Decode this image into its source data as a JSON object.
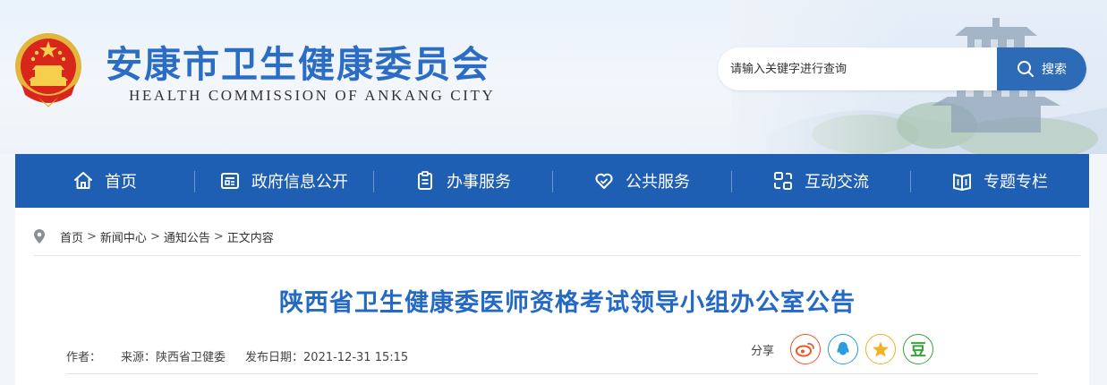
{
  "header": {
    "title": "安康市卫生健康委员会",
    "subtitle": "HEALTH COMMISSION OF ANKANG CITY"
  },
  "search": {
    "placeholder": "请输入关键字进行查询",
    "button_label": "搜索"
  },
  "nav": {
    "items": [
      {
        "label": "首页",
        "icon": "home-icon"
      },
      {
        "label": "政府信息公开",
        "icon": "document-icon"
      },
      {
        "label": "办事服务",
        "icon": "clipboard-icon"
      },
      {
        "label": "公共服务",
        "icon": "heart-icon"
      },
      {
        "label": "互动交流",
        "icon": "chat-icon"
      },
      {
        "label": "专题专栏",
        "icon": "book-icon"
      }
    ]
  },
  "breadcrumb": {
    "items": [
      "首页",
      "新闻中心",
      "通知公告",
      "正文内容"
    ],
    "separator": ">"
  },
  "article": {
    "title": "陕西省卫生健康委医师资格考试领导小组办公室公告",
    "author_label": "作者：",
    "source_label": "来源：陕西省卫健委",
    "date_label": "发布日期：2021-12-31 15:15"
  },
  "share": {
    "label": "分享",
    "buttons": [
      {
        "name": "weibo",
        "color": "#e8582a"
      },
      {
        "name": "qq",
        "color": "#2a9ce0"
      },
      {
        "name": "qzone",
        "color": "#f0b322"
      },
      {
        "name": "douban",
        "color": "#3aa33a",
        "glyph": "豆"
      }
    ]
  },
  "colors": {
    "brand_blue": "#2b6cc4",
    "nav_blue": "#1f5fb3",
    "search_button": "#2d6bb7",
    "title_blue": "#2469c4"
  }
}
